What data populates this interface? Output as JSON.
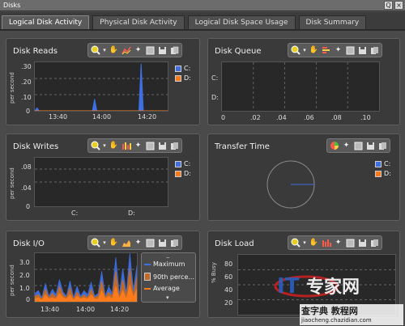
{
  "window": {
    "title": "Disks"
  },
  "title_controls": [
    "Q",
    "×"
  ],
  "tabs": [
    {
      "label": "Logical Disk Activity",
      "active": true
    },
    {
      "label": "Physical Disk Activity",
      "active": false
    },
    {
      "label": "Logical Disk Space Usage",
      "active": false
    },
    {
      "label": "Disk Summary",
      "active": false
    }
  ],
  "colors": {
    "c_drive": "#3f6fe0",
    "d_drive": "#ff7a1a",
    "plot_bg": "#282828",
    "panel_bg": "#3a3a3a"
  },
  "panels": {
    "disk_reads": {
      "title": "Disk Reads",
      "ylabel": "per second",
      "yticks": [
        ".30",
        ".20",
        ".10",
        "0"
      ],
      "xticks": [
        "13:40",
        "14:00",
        "14:20"
      ],
      "legend": [
        "C:",
        "D:"
      ]
    },
    "disk_queue": {
      "title": "Disk Queue",
      "bar_labels": [
        "C:",
        "D:"
      ],
      "xticks": [
        "0",
        ".02",
        ".04",
        ".06",
        ".08",
        ".10"
      ]
    },
    "disk_writes": {
      "title": "Disk Writes",
      "ylabel": "per second",
      "yticks": [
        ".08",
        ".04",
        "0"
      ],
      "xticks": [
        "C:",
        "D:"
      ],
      "legend": [
        "C:",
        "D:"
      ]
    },
    "transfer_time": {
      "title": "Transfer Time",
      "legend": [
        "C:",
        "D:"
      ]
    },
    "disk_io": {
      "title": "Disk I/O",
      "ylabel": "per second",
      "yticks": [
        "3.0",
        "2.0",
        "1.0",
        "0"
      ],
      "xticks": [
        "13:40",
        "14:00",
        "14:20"
      ],
      "legend": [
        "Maximum",
        "90th perce...",
        "Average"
      ]
    },
    "disk_load": {
      "title": "Disk Load",
      "ylabel": "% Busy",
      "yticks": [
        "80",
        "60",
        "40",
        "20"
      ]
    }
  },
  "chart_data": [
    {
      "type": "line",
      "title": "Disk Reads",
      "ylabel": "per second",
      "ylim": [
        0,
        0.33
      ],
      "x_labels": [
        "13:40",
        "14:00",
        "14:20"
      ],
      "series": [
        {
          "name": "C:",
          "color": "#3f6fe0",
          "x": [
            "13:30",
            "13:31",
            "13:32",
            "13:40",
            "13:50",
            "13:56",
            "13:57",
            "13:58",
            "14:00",
            "14:10",
            "14:17",
            "14:18",
            "14:19",
            "14:20",
            "14:30"
          ],
          "values": [
            0,
            0.02,
            0,
            0,
            0,
            0,
            0.08,
            0,
            0,
            0,
            0,
            0.32,
            0,
            0,
            0
          ]
        },
        {
          "name": "D:",
          "color": "#ff7a1a",
          "x": [
            "13:30",
            "14:30"
          ],
          "values": [
            0,
            0
          ]
        }
      ],
      "grid": true
    },
    {
      "type": "bar",
      "title": "Disk Queue",
      "categories": [
        "C:",
        "D:"
      ],
      "values": [
        0,
        0
      ],
      "xlim": [
        0,
        0.1
      ],
      "grid": true
    },
    {
      "type": "bar",
      "title": "Disk Writes",
      "ylabel": "per second",
      "categories": [
        "C:",
        "D:"
      ],
      "values": [
        0,
        0
      ],
      "ylim": [
        0,
        0.1
      ],
      "grid": true
    },
    {
      "type": "pie",
      "title": "Transfer Time",
      "categories": [
        "C:",
        "D:"
      ],
      "values": [
        0,
        0
      ]
    },
    {
      "type": "area",
      "title": "Disk I/O",
      "ylabel": "per second",
      "ylim": [
        0,
        3.5
      ],
      "x_labels": [
        "13:40",
        "14:00",
        "14:20"
      ],
      "series": [
        {
          "name": "Maximum",
          "color": "#3f6fe0",
          "values": [
            0.6,
            0.8,
            0.3,
            1.3,
            0.4,
            0.9,
            0.5,
            1.6,
            0.7,
            0.4,
            1.5,
            0.3,
            1.1,
            0.4,
            0.8,
            0.5,
            1.4,
            0.4,
            0.6,
            2.2,
            0.4,
            1.1,
            0.6,
            3.2,
            0.5,
            2.4,
            0.6,
            3.5,
            0.8,
            2.6
          ]
        },
        {
          "name": "90th perce...",
          "color": "#c06a2a",
          "values": [
            0.4,
            0.5,
            0.2,
            0.9,
            0.3,
            0.6,
            0.3,
            1.1,
            0.5,
            0.3,
            1.0,
            0.2,
            0.7,
            0.3,
            0.5,
            0.3,
            0.9,
            0.3,
            0.4,
            1.5,
            0.3,
            0.7,
            0.4,
            2.2,
            0.3,
            1.6,
            0.4,
            2.4,
            0.5,
            1.8
          ]
        },
        {
          "name": "Average",
          "color": "#ff7a1a",
          "values": [
            0.2,
            0.3,
            0.1,
            0.5,
            0.2,
            0.3,
            0.2,
            0.6,
            0.3,
            0.2,
            0.5,
            0.1,
            0.4,
            0.2,
            0.3,
            0.2,
            0.5,
            0.2,
            0.2,
            0.8,
            0.2,
            0.4,
            0.2,
            1.1,
            0.2,
            0.8,
            0.2,
            1.2,
            0.3,
            0.9
          ]
        }
      ],
      "grid": true
    },
    {
      "type": "bar",
      "title": "Disk Load",
      "ylabel": "% Busy",
      "ylim": [
        0,
        100
      ],
      "categories": [],
      "values": [],
      "grid": true
    }
  ],
  "watermark": {
    "logo": "IT专家网",
    "site_small": "查字典 教程网",
    "url": "jiaocheng.chazidian.com"
  }
}
